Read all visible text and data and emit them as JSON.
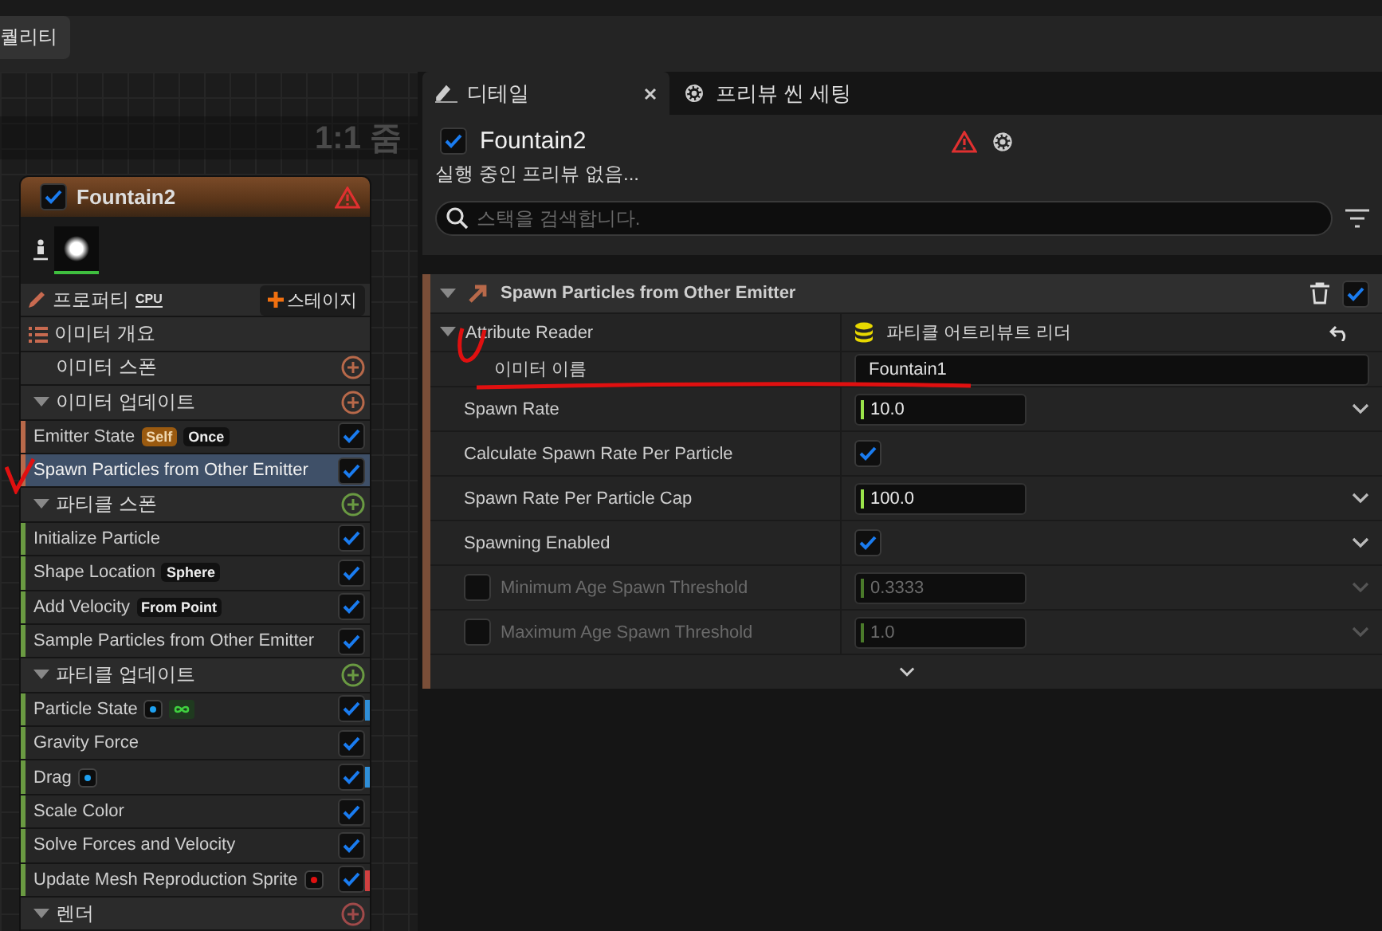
{
  "toolbar": {
    "quality_button": "퀄리티"
  },
  "graph": {
    "zoom_label": "1:1 줌",
    "node": {
      "title": "Fountain2",
      "enabled": true,
      "properties_label": "프로퍼티",
      "sim_target": "CPU",
      "add_stage_button": "스테이지",
      "sections": [
        {
          "kind": "summary",
          "title": "이미터 개요"
        },
        {
          "kind": "stage",
          "title": "이미터 스폰",
          "collapsible": false,
          "color": "#b8694a"
        },
        {
          "kind": "stage",
          "title": "이미터 업데이트",
          "collapsible": true,
          "color": "#b8694a",
          "modules": [
            {
              "name": "Emitter State",
              "enabled": true,
              "selected": false,
              "tags": [
                {
                  "kind": "scope",
                  "text": "Self"
                },
                {
                  "kind": "value",
                  "text": "Once"
                }
              ]
            },
            {
              "name": "Spawn Particles from Other Emitter",
              "enabled": true,
              "selected": true
            }
          ]
        },
        {
          "kind": "stage",
          "title": "파티클 스폰",
          "collapsible": true,
          "color": "#6a9a42",
          "modules": [
            {
              "name": "Initialize Particle",
              "enabled": true,
              "selected": false
            },
            {
              "name": "Shape Location",
              "enabled": true,
              "selected": false,
              "tags": [
                {
                  "kind": "value",
                  "text": "Sphere"
                }
              ]
            },
            {
              "name": "Add Velocity",
              "enabled": true,
              "selected": false,
              "tags": [
                {
                  "kind": "value",
                  "text": "From Point"
                }
              ]
            },
            {
              "name": "Sample Particles from Other Emitter",
              "enabled": true,
              "selected": false
            }
          ]
        },
        {
          "kind": "stage",
          "title": "파티클 업데이트",
          "collapsible": true,
          "color": "#6a9a42",
          "modules": [
            {
              "name": "Particle State",
              "enabled": true,
              "selected": false,
              "tags": [
                {
                  "kind": "dot",
                  "color": "#1ea0f0"
                },
                {
                  "kind": "loop"
                }
              ],
              "marker": {
                "color": "#2f8fd8"
              }
            },
            {
              "name": "Gravity Force",
              "enabled": true,
              "selected": false
            },
            {
              "name": "Drag",
              "enabled": true,
              "selected": false,
              "tags": [
                {
                  "kind": "dot",
                  "color": "#1ea0f0"
                }
              ],
              "marker": {
                "color": "#2f8fd8"
              }
            },
            {
              "name": "Scale Color",
              "enabled": true,
              "selected": false
            },
            {
              "name": "Solve Forces and Velocity",
              "enabled": true,
              "selected": false
            },
            {
              "name": "Update Mesh Reproduction Sprite",
              "enabled": true,
              "selected": false,
              "tags": [
                {
                  "kind": "dot",
                  "color": "#e01010"
                }
              ],
              "marker": {
                "color": "#d04040"
              }
            }
          ]
        },
        {
          "kind": "stage",
          "title": "렌더",
          "collapsible": true,
          "color": "#a04a4a"
        }
      ]
    }
  },
  "details": {
    "tabs": [
      {
        "label": "디테일",
        "selected": true,
        "closable": true
      },
      {
        "label": "프리뷰 씬 세팅",
        "selected": false,
        "closable": false
      }
    ],
    "emitter": {
      "name": "Fountain2",
      "enabled": true
    },
    "status": "실행 중인 프리뷰 없음...",
    "search": {
      "placeholder": "스택을 검색합니다."
    },
    "module": {
      "title": "Spawn Particles from Other Emitter",
      "enabled": true,
      "properties": [
        {
          "kind": "object",
          "label": "Attribute Reader",
          "value": "파티클 어트리뷰트 리더",
          "expanded": true,
          "children": [
            {
              "kind": "text",
              "label": "이미터 이름",
              "value": "Fountain1"
            }
          ]
        },
        {
          "kind": "number",
          "label": "Spawn Rate",
          "value": "10.0",
          "dropdown": true
        },
        {
          "kind": "checkbox",
          "label": "Calculate Spawn Rate Per Particle",
          "checked": true,
          "dropdown": false
        },
        {
          "kind": "number",
          "label": "Spawn Rate Per Particle Cap",
          "value": "100.0",
          "dropdown": true
        },
        {
          "kind": "checkbox",
          "label": "Spawning Enabled",
          "checked": true,
          "dropdown": true
        },
        {
          "kind": "number",
          "label": "Minimum Age Spawn Threshold",
          "value": "0.3333",
          "dropdown": true,
          "toggle": {
            "checked": false
          }
        },
        {
          "kind": "number",
          "label": "Maximum Age Spawn Threshold",
          "value": "1.0",
          "dropdown": true,
          "toggle": {
            "checked": false
          }
        }
      ]
    }
  }
}
